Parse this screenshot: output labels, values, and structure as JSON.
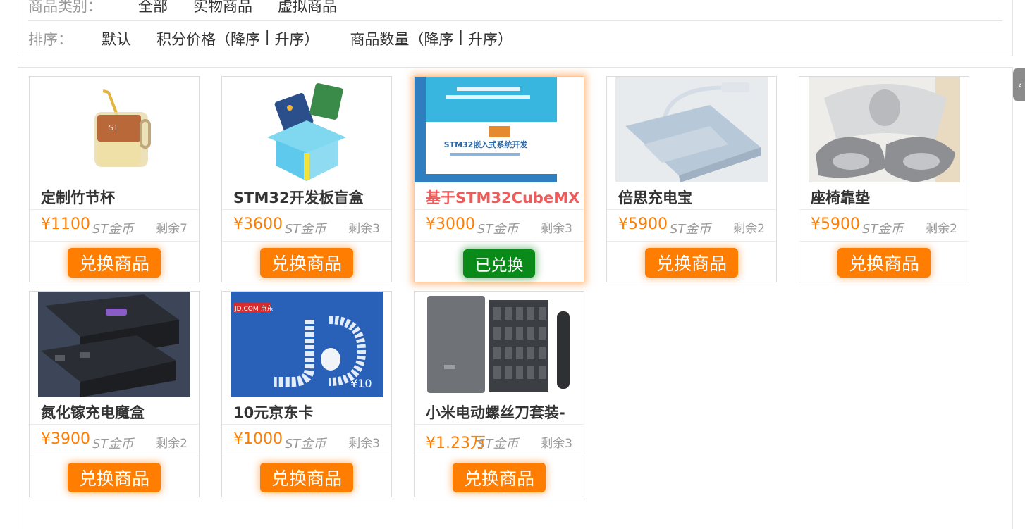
{
  "filters": {
    "category_label": "商品类别：",
    "categories": [
      "全部",
      "实物商品",
      "虚拟商品"
    ],
    "sort_label": "排序：",
    "sort_default": "默认",
    "sort_points": {
      "name": "积分价格（",
      "desc": "降序",
      "sep": " | ",
      "asc": "升序",
      "close": "）"
    },
    "sort_quantity": {
      "name": "商品数量（",
      "desc": "降序",
      "sep": " | ",
      "asc": "升序",
      "close": "）"
    }
  },
  "side_tab_icon": "chevron-left-icon",
  "colors": {
    "accent": "#ff7d00",
    "redeemed": "#0a8a18",
    "active_title": "#ef5b5b"
  },
  "products": [
    {
      "title": "定制竹节杯",
      "price": "¥1100",
      "unit": "ST金币",
      "stock": "剩余7",
      "button": "兑换商品",
      "image": "cup-image"
    },
    {
      "title": "STM32开发板盲盒",
      "price": "¥3600",
      "unit": "ST金币",
      "stock": "剩余3",
      "button": "兑换商品",
      "image": "blind-box-image"
    },
    {
      "title": "基于STM32CubeMX",
      "price": "¥3000",
      "unit": "ST金币",
      "stock": "剩余3",
      "button": "已兑换",
      "image": "book-cover-image",
      "cover_text": "STM32嵌入式系统开发"
    },
    {
      "title": "倍思充电宝",
      "price": "¥5900",
      "unit": "ST金币",
      "stock": "剩余2",
      "button": "兑换商品",
      "image": "power-bank-image"
    },
    {
      "title": "座椅靠垫",
      "price": "¥5900",
      "unit": "ST金币",
      "stock": "剩余2",
      "button": "兑换商品",
      "image": "seat-cushion-image"
    },
    {
      "title": "氮化镓充电魔盒",
      "price": "¥3900",
      "unit": "ST金币",
      "stock": "剩余2",
      "button": "兑换商品",
      "image": "power-strip-image"
    },
    {
      "title": "10元京东卡",
      "price": "¥1000",
      "unit": "ST金币",
      "stock": "剩余3",
      "button": "兑换商品",
      "image": "jd-card-image",
      "card_brand": "JD.COM 京东",
      "card_value": "¥10"
    },
    {
      "title": "小米电动螺丝刀套装-",
      "price": "¥1.23万",
      "unit": "ST金币",
      "stock": "剩余3",
      "button": "兑换商品",
      "image": "screwdriver-set-image"
    }
  ]
}
